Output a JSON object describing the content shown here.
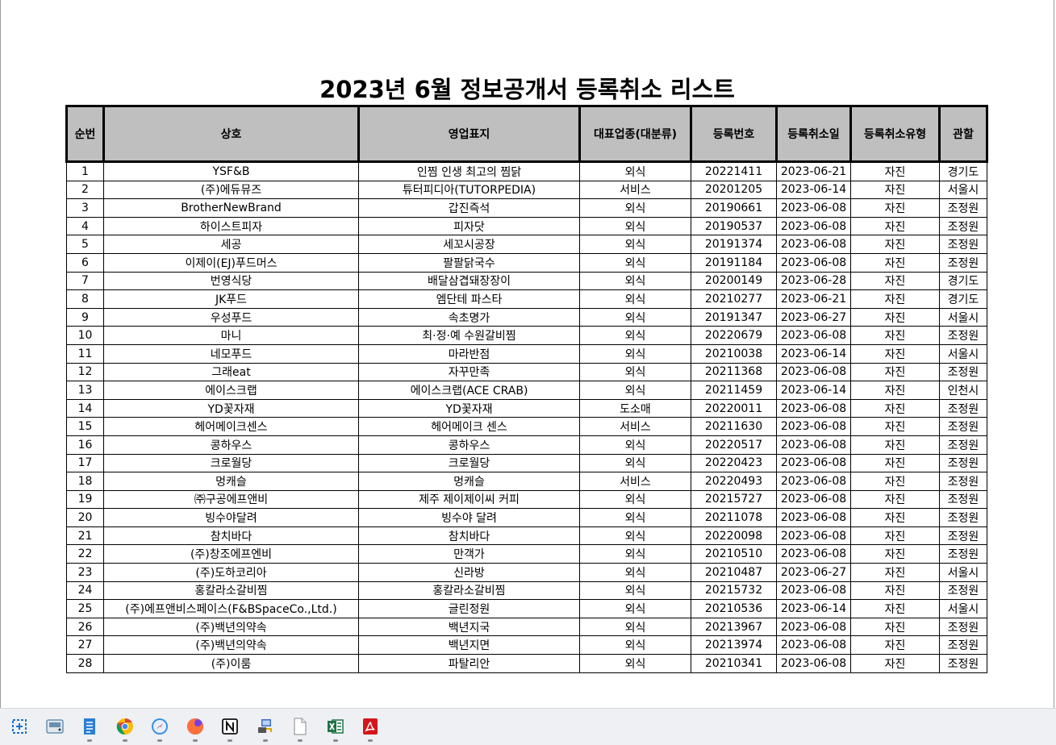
{
  "title": "2023년 6월 정보공개서 등록취소 리스트",
  "columns": [
    "순번",
    "상호",
    "영업표지",
    "대표업종(대분류)",
    "등록번호",
    "등록취소일",
    "등록취소유형",
    "관할"
  ],
  "rows": [
    [
      "1",
      "YSF&B",
      "인찜 인생 최고의 찜닭",
      "외식",
      "20221411",
      "2023-06-21",
      "자진",
      "경기도"
    ],
    [
      "2",
      "(주)에듀뮤즈",
      "튜터피디아(TUTORPEDIA)",
      "서비스",
      "20201205",
      "2023-06-14",
      "자진",
      "서울시"
    ],
    [
      "3",
      "BrotherNewBrand",
      "갑진즉석",
      "외식",
      "20190661",
      "2023-06-08",
      "자진",
      "조정원"
    ],
    [
      "4",
      "하이스트피자",
      "피자닷",
      "외식",
      "20190537",
      "2023-06-08",
      "자진",
      "조정원"
    ],
    [
      "5",
      "세공",
      "세꼬시공장",
      "외식",
      "20191374",
      "2023-06-08",
      "자진",
      "조정원"
    ],
    [
      "6",
      "이제이(EJ)푸드머스",
      "팔팔닭국수",
      "외식",
      "20191184",
      "2023-06-08",
      "자진",
      "조정원"
    ],
    [
      "7",
      "번영식당",
      "배달삼겹돼장장이",
      "외식",
      "20200149",
      "2023-06-28",
      "자진",
      "경기도"
    ],
    [
      "8",
      "JK푸드",
      "엠단테 파스타",
      "외식",
      "20210277",
      "2023-06-21",
      "자진",
      "경기도"
    ],
    [
      "9",
      "우성푸드",
      "속초명가",
      "외식",
      "20191347",
      "2023-06-27",
      "자진",
      "서울시"
    ],
    [
      "10",
      "마니",
      "최·정·예 수원갈비찜",
      "외식",
      "20220679",
      "2023-06-08",
      "자진",
      "조정원"
    ],
    [
      "11",
      "네모푸드",
      "마라반점",
      "외식",
      "20210038",
      "2023-06-14",
      "자진",
      "서울시"
    ],
    [
      "12",
      "그래eat",
      "자꾸만족",
      "외식",
      "20211368",
      "2023-06-08",
      "자진",
      "조정원"
    ],
    [
      "13",
      "에이스크랩",
      "에이스크랩(ACE CRAB)",
      "외식",
      "20211459",
      "2023-06-14",
      "자진",
      "인천시"
    ],
    [
      "14",
      "YD꽃자재",
      "YD꽃자재",
      "도소매",
      "20220011",
      "2023-06-08",
      "자진",
      "조정원"
    ],
    [
      "15",
      "헤어메이크센스",
      "헤어메이크 센스",
      "서비스",
      "20211630",
      "2023-06-08",
      "자진",
      "조정원"
    ],
    [
      "16",
      "콩하우스",
      "콩하우스",
      "외식",
      "20220517",
      "2023-06-08",
      "자진",
      "조정원"
    ],
    [
      "17",
      "크로월당",
      "크로월당",
      "외식",
      "20220423",
      "2023-06-08",
      "자진",
      "조정원"
    ],
    [
      "18",
      "멍캐슬",
      "멍캐슬",
      "서비스",
      "20220493",
      "2023-06-08",
      "자진",
      "조정원"
    ],
    [
      "19",
      "㈜구공에프앤비",
      "제주 제이제이씨 커피",
      "외식",
      "20215727",
      "2023-06-08",
      "자진",
      "조정원"
    ],
    [
      "20",
      "빙수야달려",
      "빙수야 달려",
      "외식",
      "20211078",
      "2023-06-08",
      "자진",
      "조정원"
    ],
    [
      "21",
      "참치바다",
      "참치바다",
      "외식",
      "20220098",
      "2023-06-08",
      "자진",
      "조정원"
    ],
    [
      "22",
      "(주)창조에프엔비",
      "만객가",
      "외식",
      "20210510",
      "2023-06-08",
      "자진",
      "조정원"
    ],
    [
      "23",
      "(주)도하코리아",
      "신라방",
      "외식",
      "20210487",
      "2023-06-27",
      "자진",
      "서울시"
    ],
    [
      "24",
      "홍칼라소갈비찜",
      "홍칼라소갈비찜",
      "외식",
      "20215732",
      "2023-06-08",
      "자진",
      "조정원"
    ],
    [
      "25",
      "(주)에프앤비스페이스(F&BSpaceCo.,Ltd.)",
      "글린정원",
      "외식",
      "20210536",
      "2023-06-14",
      "자진",
      "서울시"
    ],
    [
      "26",
      "(주)백년의약속",
      "백년지국",
      "외식",
      "20213967",
      "2023-06-08",
      "자진",
      "조정원"
    ],
    [
      "27",
      "(주)백년의약속",
      "백년지면",
      "외식",
      "20213974",
      "2023-06-08",
      "자진",
      "조정원"
    ],
    [
      "28",
      "(주)이룸",
      "파탈리안",
      "외식",
      "20210341",
      "2023-06-08",
      "자진",
      "조정원"
    ]
  ],
  "taskbar": [
    {
      "icon": "snipping-tool-icon",
      "color": "#1a73c8"
    },
    {
      "icon": "hard-drive-icon",
      "color": "#6b8fb0"
    },
    {
      "icon": "notepad-icon",
      "color": "#2b7fd4"
    },
    {
      "icon": "chrome-icon",
      "color": "#db4437"
    },
    {
      "icon": "safari-icon",
      "color": "#3a8ee6"
    },
    {
      "icon": "firefox-icon",
      "color": "#ff7139"
    },
    {
      "icon": "notion-icon",
      "color": "#111111"
    },
    {
      "icon": "network-pc-icon",
      "color": "#3b6cc9"
    },
    {
      "icon": "blank-file-icon",
      "color": "#ffffff"
    },
    {
      "icon": "excel-icon",
      "color": "#1f7244"
    },
    {
      "icon": "acrobat-icon",
      "color": "#d4161c"
    }
  ]
}
